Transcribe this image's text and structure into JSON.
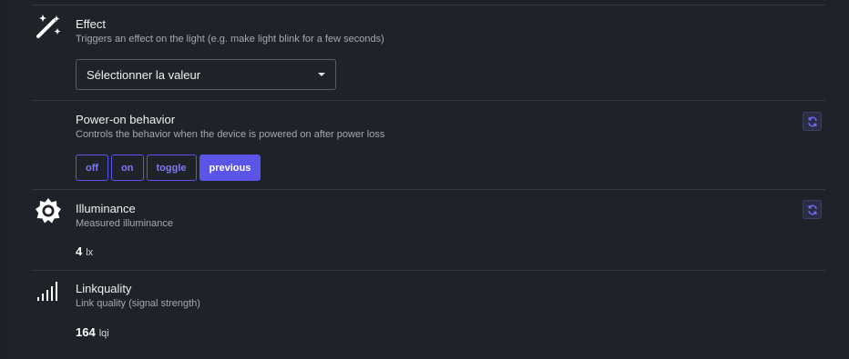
{
  "effect": {
    "title": "Effect",
    "description": "Triggers an effect on the light (e.g. make light blink for a few seconds)",
    "select_value": "Sélectionner la valeur",
    "icon": "magic-wand-icon"
  },
  "power_on": {
    "title": "Power-on behavior",
    "description": "Controls the behavior when the device is powered on after power loss",
    "options": [
      "off",
      "on",
      "toggle",
      "previous"
    ],
    "selected": "previous",
    "refresh_icon": "refresh-icon"
  },
  "illuminance": {
    "title": "Illuminance",
    "description": "Measured illuminance",
    "value": "4",
    "unit": "lx",
    "icon": "sun-icon",
    "refresh_icon": "refresh-icon"
  },
  "linkquality": {
    "title": "Linkquality",
    "description": "Link quality (signal strength)",
    "value": "164",
    "unit": "lqi",
    "icon": "signal-icon"
  },
  "colors": {
    "accent": "#5a55e8",
    "background": "#1f2329",
    "separator": "#343a43"
  }
}
